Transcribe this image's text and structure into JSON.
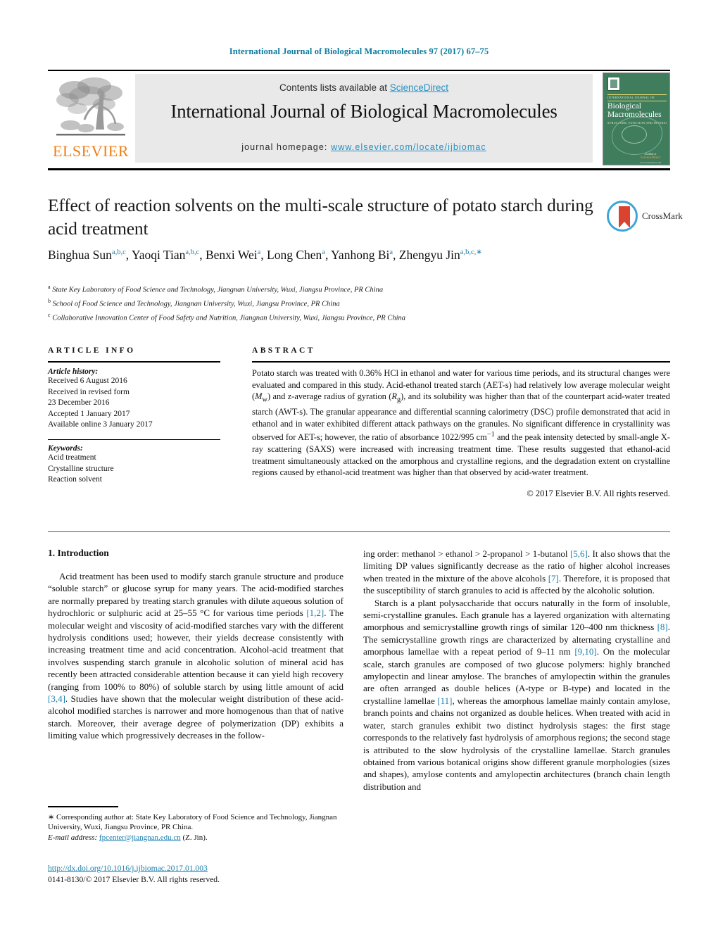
{
  "running_head": "International Journal of Biological Macromolecules 97 (2017) 67–75",
  "masthead": {
    "contents_prefix": "Contents lists available at ",
    "sciencedirect": "ScienceDirect",
    "journal_title": "International Journal of Biological Macromolecules",
    "homepage_prefix": "journal homepage: ",
    "homepage_url": "www.elsevier.com/locate/ijbiomac",
    "publisher": "ELSEVIER",
    "cover": {
      "kicker": "INTERNATIONAL JOURNAL OF",
      "name_line1": "Biological",
      "name_line2": "Macromolecules",
      "subtitle": "STRUCTURE, FUNCTION AND INTERACTIONS",
      "available_at": "available at",
      "sd_name": "ScienceDirect",
      "sd_url": "www.sciencedirect.com"
    },
    "colors": {
      "link": "#2591c4",
      "running_head": "#0b7ba0",
      "elsevier_orange": "#f07f13",
      "cover_green": "#3f7d5d"
    }
  },
  "article": {
    "title": "Effect of reaction solvents on the multi-scale structure of potato starch during acid treatment",
    "crossmark_label": "CrossMark",
    "authors_html": "Binghua Sun<sup>a,b,c</sup>, Yaoqi Tian<sup>a,b,c</sup>, Benxi Wei<sup>a</sup>, Long Chen<sup>a</sup>, Yanhong Bi<sup>a</sup>, Zhengyu Jin<sup>a,b,c,<span class=\"star\">∗</span></sup>",
    "affiliations": [
      {
        "marker": "a",
        "text": "State Key Laboratory of Food Science and Technology, Jiangnan University, Wuxi, Jiangsu Province, PR China"
      },
      {
        "marker": "b",
        "text": "School of Food Science and Technology, Jiangnan University, Wuxi, Jiangsu Province, PR China"
      },
      {
        "marker": "c",
        "text": "Collaborative Innovation Center of Food Safety and Nutrition, Jiangnan University, Wuxi, Jiangsu Province, PR China"
      }
    ]
  },
  "article_info": {
    "heading": "ARTICLE INFO",
    "history_label": "Article history:",
    "history": [
      "Received 6 August 2016",
      "Received in revised form",
      "23 December 2016",
      "Accepted 1 January 2017",
      "Available online 3 January 2017"
    ],
    "keywords_label": "Keywords:",
    "keywords": [
      "Acid treatment",
      "Crystalline structure",
      "Reaction solvent"
    ]
  },
  "abstract": {
    "heading": "ABSTRACT",
    "body_html": "Potato starch was treated with 0.36% HCl in ethanol and water for various time periods, and its structural changes were evaluated and compared in this study. Acid-ethanol treated starch (AET-s) had relatively low average molecular weight (<i>M</i><sub>w</sub>) and z-average radius of gyration (<i>R</i><sub>g</sub>), and its solubility was higher than that of the counterpart acid-water treated starch (AWT-s). The granular appearance and differential scanning calorimetry (DSC) profile demonstrated that acid in ethanol and in water exhibited different attack pathways on the granules. No significant difference in crystallinity was observed for AET-s; however, the ratio of absorbance 1022/995 cm<sup>−1</sup> and the peak intensity detected by small-angle X-ray scattering (SAXS) were increased with increasing treatment time. These results suggested that ethanol-acid treatment simultaneously attacked on the amorphous and crystalline regions, and the degradation extent on crystalline regions caused by ethanol-acid treatment was higher than that observed by acid-water treatment.",
    "copyright": "© 2017 Elsevier B.V. All rights reserved."
  },
  "body": {
    "section_heading": "1.  Introduction",
    "left_paragraphs_html": [
      "Acid treatment has been used to modify starch granule structure and produce “soluble starch” or glucose syrup for many years. The acid-modified starches are normally prepared by treating starch granules with dilute aqueous solution of hydrochloric or sulphuric acid at 25–55 °C for various time periods <span class=\"ref\">[1,2]</span>. The molecular weight and viscosity of acid-modified starches vary with the different hydrolysis conditions used; however, their yields decrease consistently with increasing treatment time and acid concentration. Alcohol-acid treatment that involves suspending starch granule in alcoholic solution of mineral acid has recently been attracted considerable attention because it can yield high recovery (ranging from 100% to 80%) of soluble starch by using little amount of acid <span class=\"ref\">[3,4]</span>. Studies have shown that the molecular weight distribution of these acid-alcohol modified starches is narrower and more homogenous than that of native starch. Moreover, their average degree of polymerization (DP) exhibits a limiting value which progressively decreases in the follow-"
    ],
    "right_paragraphs_html": [
      "ing order: methanol > ethanol > 2-propanol > 1-butanol <span class=\"ref\">[5,6]</span>. It also shows that the limiting DP values significantly decrease as the ratio of higher alcohol increases when treated in the mixture of the above alcohols <span class=\"ref\">[7]</span>. Therefore, it is proposed that the susceptibility of starch granules to acid is affected by the alcoholic solution.",
      "Starch is a plant polysaccharide that occurs naturally in the form of insoluble, semi-crystalline granules. Each granule has a layered organization with alternating amorphous and semicrystalline growth rings of similar 120–400 nm thickness <span class=\"ref\">[8]</span>. The semicrystalline growth rings are characterized by alternating crystalline and amorphous lamellae with a repeat period of 9–11 nm <span class=\"ref\">[9,10]</span>. On the molecular scale, starch granules are composed of two glucose polymers: highly branched amylopectin and linear amylose. The branches of amylopectin within the granules are often arranged as double helices (A-type or B-type) and located in the crystalline lamellae <span class=\"ref\">[11]</span>, whereas the amorphous lamellae mainly contain amylose, branch points and chains not organized as double helices. When treated with acid in water, starch granules exhibit two distinct hydrolysis stages: the first stage corresponds to the relatively fast hydrolysis of amorphous regions; the second stage is attributed to the slow hydrolysis of the crystalline lamellae. Starch granules obtained from various botanical origins show different granule morphologies (sizes and shapes), amylose contents and amylopectin architectures (branch chain length distribution and"
    ]
  },
  "footer": {
    "corresponding_html": "<span class=\"star\">∗</span> Corresponding author at: State Key Laboratory of Food Science and Technology, Jiangnan University, Wuxi, Jiangsu Province, PR China.",
    "email_label": "E-mail address:",
    "email": "fpcenter@jiangnan.edu.cn",
    "email_suffix": "(Z. Jin).",
    "doi": "http://dx.doi.org/10.1016/j.ijbiomac.2017.01.003",
    "issn_line": "0141-8130/© 2017 Elsevier B.V. All rights reserved."
  }
}
